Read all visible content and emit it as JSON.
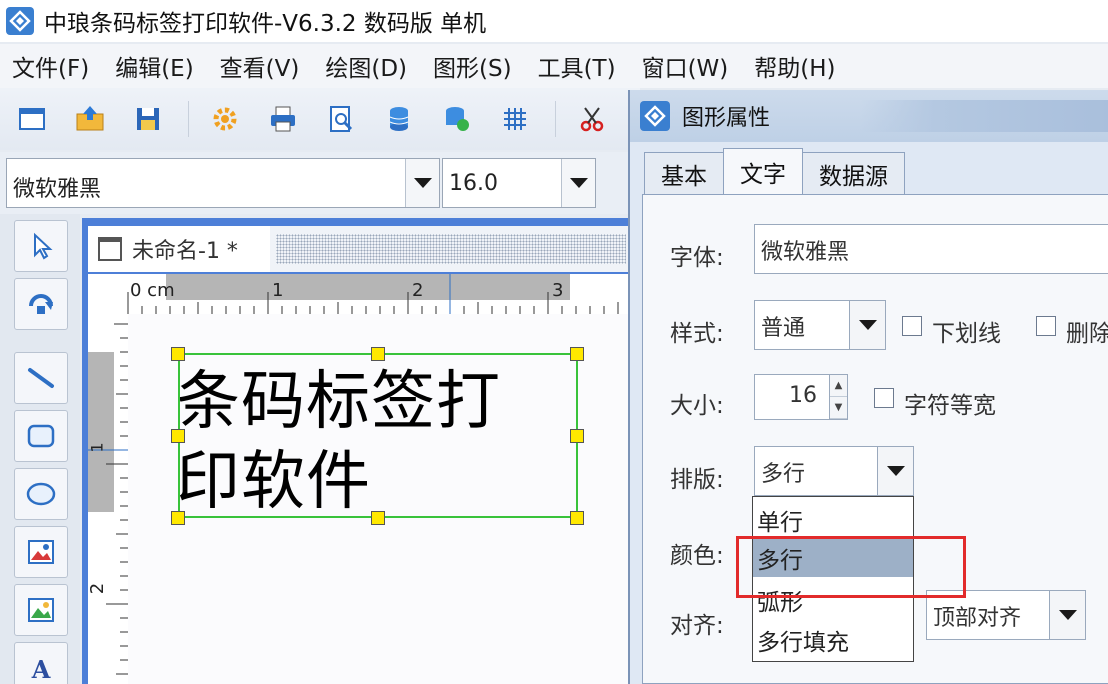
{
  "window": {
    "title": "中琅条码标签打印软件-V6.3.2 数码版 单机"
  },
  "menu": [
    "文件(F)",
    "编辑(E)",
    "查看(V)",
    "绘图(D)",
    "图形(S)",
    "工具(T)",
    "窗口(W)",
    "帮助(H)"
  ],
  "toolbar": {
    "buttons": [
      "new-icon",
      "open-icon",
      "save-icon",
      "settings-icon",
      "print-icon",
      "print-preview-icon",
      "database-icon",
      "database-settings-icon",
      "grid-icon",
      "cut-icon"
    ]
  },
  "fontbar": {
    "font": "微软雅黑",
    "size": "16.0"
  },
  "tools": [
    "pointer-icon",
    "rotate-icon",
    "line-icon",
    "rounded-rect-icon",
    "ellipse-icon",
    "image-icon",
    "picture-icon",
    "text-icon"
  ],
  "document": {
    "tab_title": "未命名-1 *",
    "ruler_labels": [
      "0 cm",
      "1",
      "2",
      "3"
    ],
    "ruler_v_labels": [
      "1",
      "2"
    ],
    "text_line1": "条码标签打",
    "text_line2": "印软件"
  },
  "dialog": {
    "title": "图形属性",
    "tabs": [
      "基本",
      "文字",
      "数据源"
    ],
    "active_tab": "文字",
    "font_label": "字体:",
    "font_value": "微软雅黑",
    "style_label": "样式:",
    "style_value": "普通",
    "underline_label": "下划线",
    "strike_label": "删除",
    "size_label": "大小:",
    "size_value": "16",
    "monospace_label": "字符等宽",
    "layout_label": "排版:",
    "layout_value": "多行",
    "color_label": "颜色:",
    "align_label": "对齐:",
    "align_value": "顶部对齐",
    "layout_options": [
      "单行",
      "多行",
      "弧形",
      "多行填充"
    ],
    "selected_option": "多行"
  },
  "colors": {
    "accent": "#3a7fd0",
    "selection": "#39c33a",
    "handle": "#ffe800",
    "highlight": "#e22b2b",
    "docframe": "#4d7fd8"
  }
}
